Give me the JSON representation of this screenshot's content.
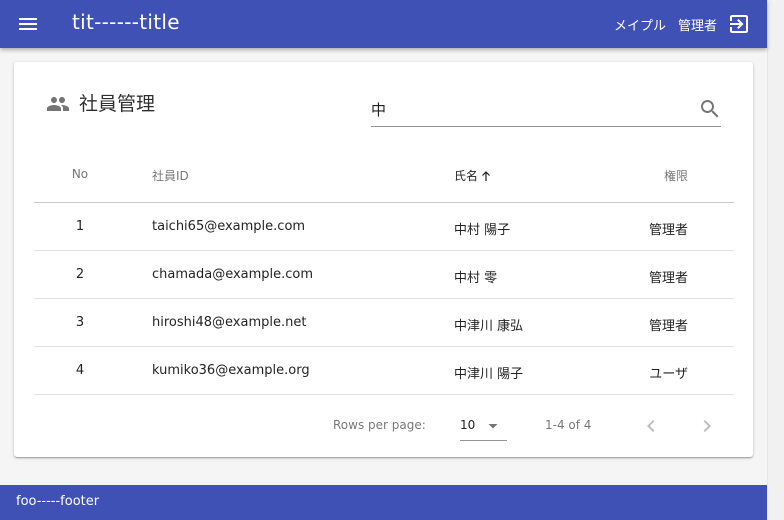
{
  "header": {
    "title": "tit------title",
    "user_name": "メイプル",
    "user_role": "管理者",
    "menu_icon": "menu-icon",
    "logout_icon": "logout-icon",
    "color": "#3f51b5"
  },
  "card": {
    "icon": "people-icon",
    "title": "社員管理",
    "search": {
      "value": "中",
      "placeholder": "",
      "icon": "search-icon"
    }
  },
  "table": {
    "columns": [
      {
        "key": "no",
        "label": "No"
      },
      {
        "key": "id",
        "label": "社員ID"
      },
      {
        "key": "name",
        "label": "氏名",
        "sorted": "asc"
      },
      {
        "key": "role",
        "label": "権限"
      }
    ],
    "rows": [
      {
        "no": "1",
        "id": "taichi65@example.com",
        "name": "中村 陽子",
        "role": "管理者"
      },
      {
        "no": "2",
        "id": "chamada@example.com",
        "name": "中村 零",
        "role": "管理者"
      },
      {
        "no": "3",
        "id": "hiroshi48@example.net",
        "name": "中津川 康弘",
        "role": "管理者"
      },
      {
        "no": "4",
        "id": "kumiko36@example.org",
        "name": "中津川 陽子",
        "role": "ユーザ"
      }
    ]
  },
  "pagination": {
    "rows_per_page_label": "Rows per page:",
    "rows_per_page": "10",
    "range": "1-4 of 4"
  },
  "footer": {
    "text": "foo-----footer"
  }
}
